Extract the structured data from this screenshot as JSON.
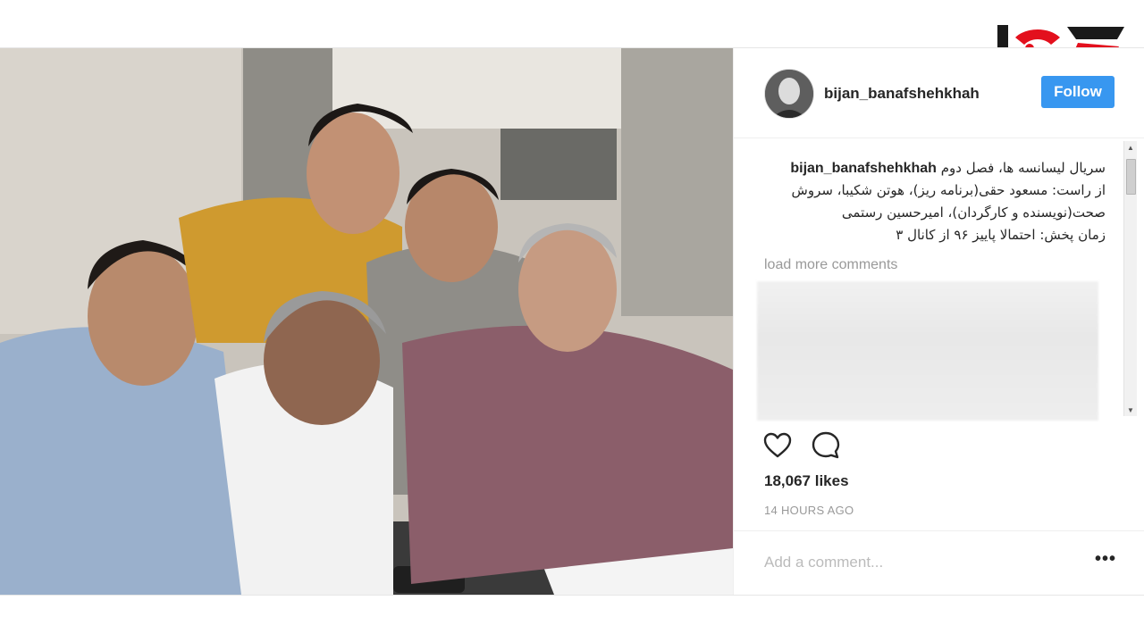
{
  "logo": {
    "alt": "rokna"
  },
  "post": {
    "username": "bijan_banafshehkhah",
    "follow_label": "Follow",
    "caption": {
      "username": "bijan_banafshehkhah",
      "line1": "سریال لیسانسه ها، فصل دوم",
      "line2": "از راست: مسعود حقی(برنامه ریز)، هوتن شکیبا، سروش صحت(نویسنده و کارگردان)، امیرحسین رستمی",
      "line3": "زمان پخش: احتمالا پاییز ۹۶ از کانال ۳"
    },
    "load_more": "load more comments",
    "likes": "18,067 likes",
    "time": "14 HOURS AGO",
    "add_comment_placeholder": "Add a comment...",
    "more_label": "•••"
  },
  "icons": {
    "like": "heart-icon",
    "comment": "comment-icon",
    "scroll_up": "scroll-up-icon",
    "scroll_down": "scroll-down-icon"
  },
  "colors": {
    "follow_bg": "#3897f0",
    "logo_red": "#e3101d",
    "text": "#262626",
    "muted": "#999999"
  }
}
